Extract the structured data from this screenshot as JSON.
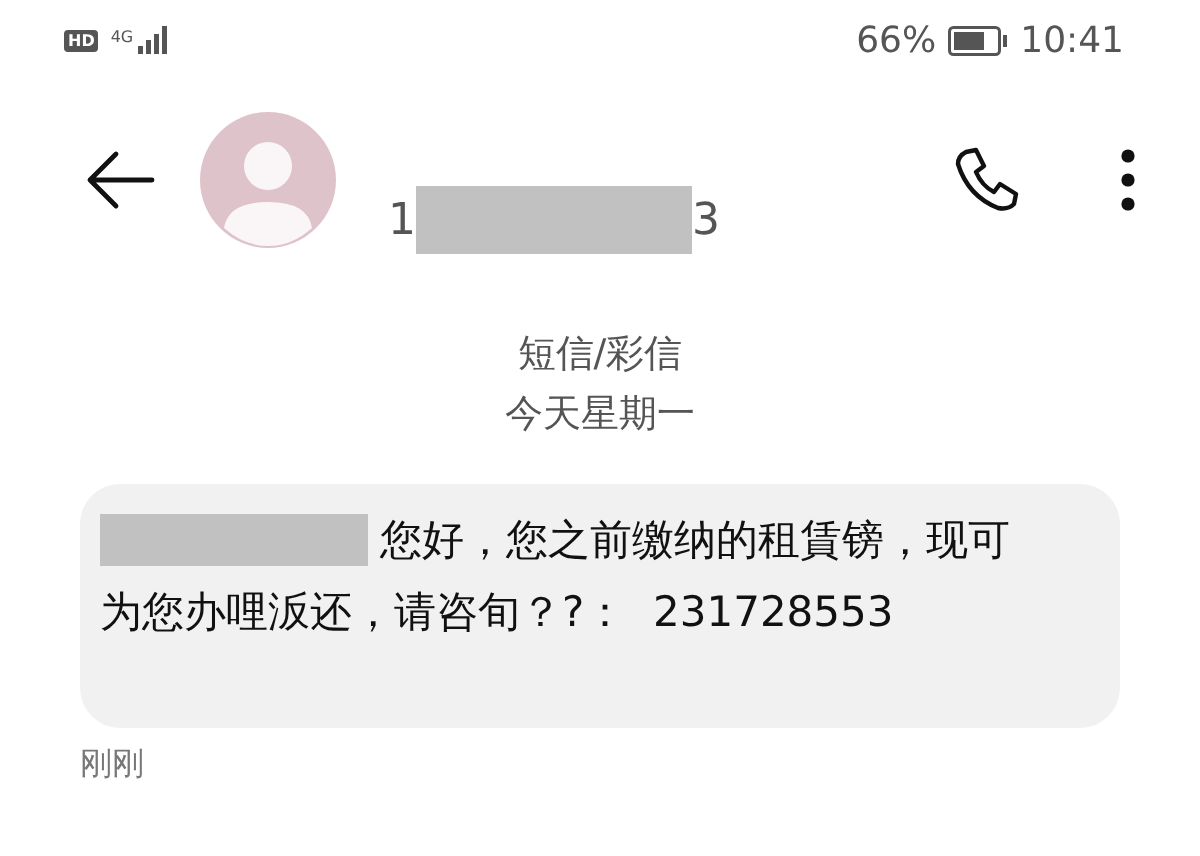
{
  "status_bar": {
    "hd_badge": "HD",
    "network_type": "4G",
    "battery_percent": "66%",
    "time": "10:41"
  },
  "header": {
    "number_start": "1",
    "number_end": "3"
  },
  "conversation": {
    "channel": "短信/彩信",
    "date": "今天星期一"
  },
  "message": {
    "lines": [
      "您好，您之前缴纳的租賃镑，现可",
      "为您办哩汳还，请咨旬？?：  231728553"
    ],
    "time": "刚刚"
  }
}
